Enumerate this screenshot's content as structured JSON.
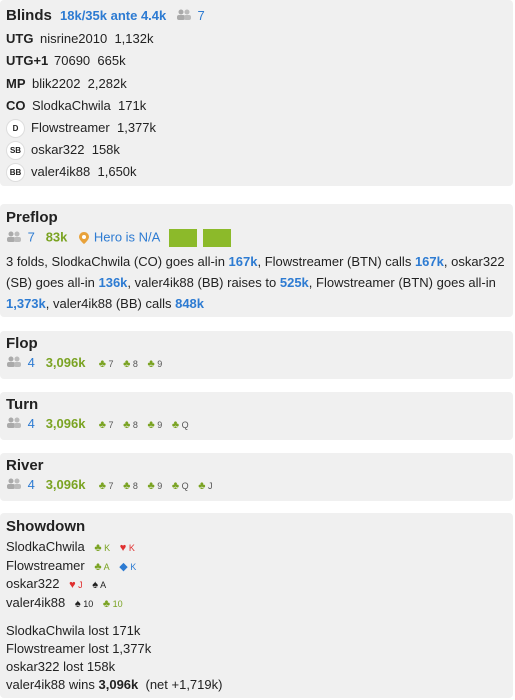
{
  "blinds": {
    "title": "Blinds",
    "stakes": "18k/35k ante 4.4k",
    "players_count": "7",
    "rows": [
      {
        "pos": "UTG",
        "name": "nisrine2010",
        "stack": "1,132k"
      },
      {
        "pos": "UTG+1",
        "name": "70690",
        "stack": "665k"
      },
      {
        "pos": "MP",
        "name": "blik2202",
        "stack": "2,282k"
      },
      {
        "pos": "CO",
        "name": "SlodkaChwila",
        "stack": "171k"
      },
      {
        "pos": "D",
        "name": "Flowstreamer",
        "stack": "1,377k"
      },
      {
        "pos": "SB",
        "name": "oskar322",
        "stack": "158k"
      },
      {
        "pos": "BB",
        "name": "valer4ik88",
        "stack": "1,650k"
      }
    ]
  },
  "preflop": {
    "title": "Preflop",
    "players": "7",
    "pot": "83k",
    "hero": "Hero is N/A",
    "action": {
      "t1": "3 folds, SlodkaChwila (CO) goes all-in ",
      "a1": "167k",
      "t2": ", Flowstreamer (BTN) calls ",
      "a2": "167k",
      "t3": ", oskar322 (SB) goes all-in ",
      "a3": "136k",
      "t4": ", valer4ik88 (BB) raises to ",
      "a4": "525k",
      "t5": ", Flowstreamer (BTN) goes all-in ",
      "a5": "1,373k",
      "t6": ", valer4ik88 (BB) calls ",
      "a6": "848k"
    }
  },
  "flop": {
    "title": "Flop",
    "players": "4",
    "pot": "3,096k",
    "cards": [
      "7",
      "8",
      "9"
    ]
  },
  "turn": {
    "title": "Turn",
    "players": "4",
    "pot": "3,096k",
    "cards": [
      "7",
      "8",
      "9",
      "Q"
    ]
  },
  "river": {
    "title": "River",
    "players": "4",
    "pot": "3,096k",
    "cards": [
      "7",
      "8",
      "9",
      "Q",
      "J"
    ]
  },
  "showdown": {
    "title": "Showdown",
    "hands": [
      {
        "name": "SlodkaChwila",
        "c1": "K",
        "c2": "K"
      },
      {
        "name": "Flowstreamer",
        "c1": "A",
        "c2": "K"
      },
      {
        "name": "oskar322",
        "c1": "J",
        "c2": "A"
      },
      {
        "name": "valer4ik88",
        "c1": "10",
        "c2": "10"
      }
    ],
    "results": [
      "SlodkaChwila lost 171k",
      "Flowstreamer lost 1,377k",
      "oskar322 lost 158k"
    ],
    "win": {
      "pre": "valer4ik88 wins ",
      "amount": "3,096k",
      "post": "  (net +1,719k)"
    }
  },
  "colors": {
    "blue": "#2d7bd2",
    "green": "#7aa322",
    "panel": "#f0f0f0",
    "hero_box": "#8cba2a"
  }
}
